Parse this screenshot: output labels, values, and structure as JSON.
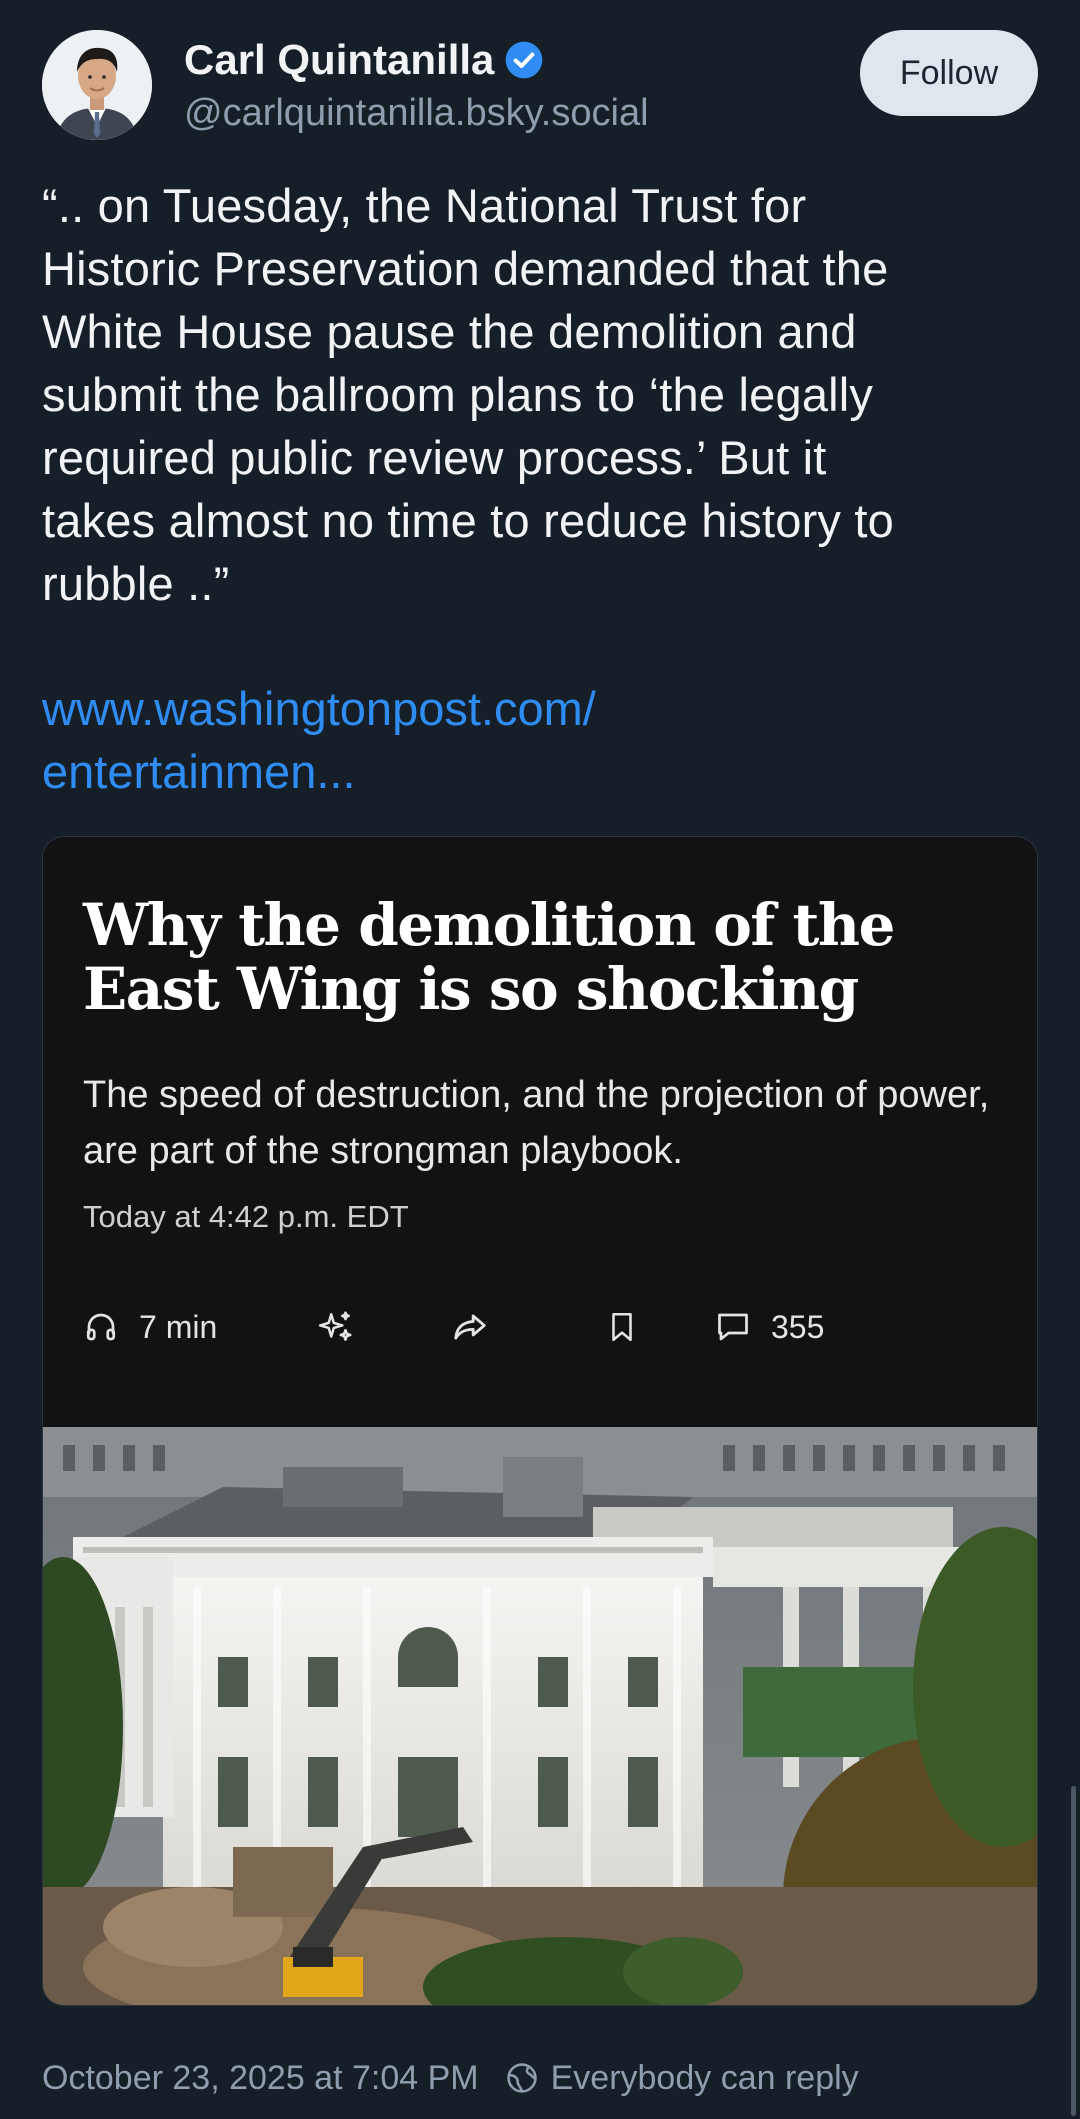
{
  "author": {
    "name": "Carl Quintanilla",
    "handle": "@carlquintanilla.bsky.social",
    "verified": true
  },
  "follow_label": "Follow",
  "post": {
    "text": "“.. on Tuesday, the National Trust for\nHistoric Preservation demanded that the\nWhite House pause the demolition and\nsubmit the ballroom plans to ‘the legally\nrequired public review process.’ But it\ntakes almost no time to reduce history to\nrubble ..”",
    "link_line1": "www.washingtonpost.com/",
    "link_line2": "entertainmen..."
  },
  "link_card": {
    "headline": "Why the demolition of the East Wing is so shocking",
    "subhead": "The speed of destruction, and the projection of power, are part of the strongman playbook.",
    "timestamp": "Today at 4:42 p.m. EDT",
    "listen_time": "7 min",
    "comment_count": "355",
    "icons": [
      "headphones-icon",
      "sparkle-icon",
      "share-icon",
      "bookmark-icon",
      "comment-icon"
    ]
  },
  "footer": {
    "date": "October 23, 2025 at 7:04 PM",
    "reply_setting": "Everybody can reply"
  },
  "colors": {
    "background": "#161e27",
    "link": "#2f8cf3",
    "muted": "#8f9eae",
    "verified": "#2f8cf3",
    "follow_bg": "#dfe6ee"
  }
}
